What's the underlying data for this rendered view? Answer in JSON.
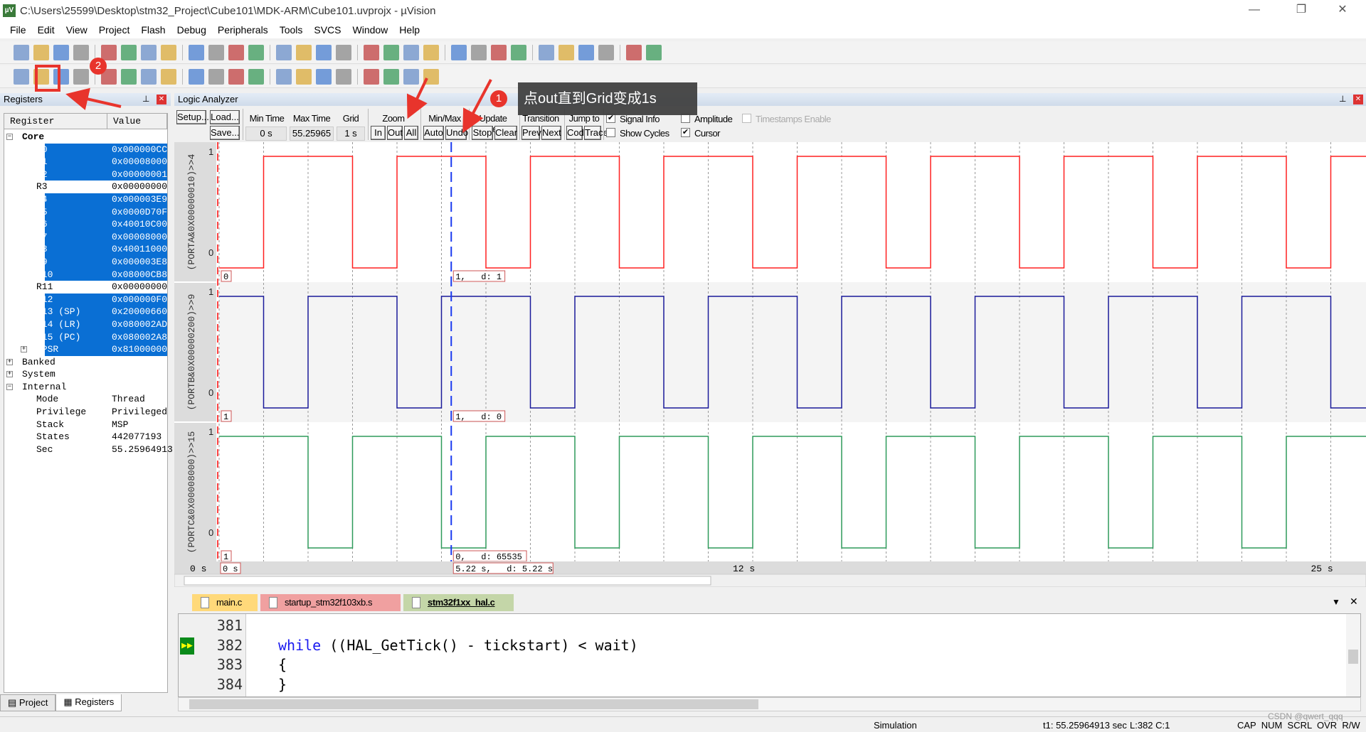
{
  "window": {
    "title": "C:\\Users\\25599\\Desktop\\stm32_Project\\Cube101\\MDK-ARM\\Cube101.uvprojx - µVision",
    "app_icon": "uvision-logo",
    "minimize": "—",
    "restore": "❐",
    "close": "✕"
  },
  "menu": [
    "File",
    "Edit",
    "View",
    "Project",
    "Flash",
    "Debug",
    "Peripherals",
    "Tools",
    "SVCS",
    "Window",
    "Help"
  ],
  "toolbar1": [
    "new-file",
    "open-file",
    "save",
    "save-all",
    "cut",
    "copy",
    "paste",
    "undo",
    "redo",
    "navigate-back",
    "navigate-forward",
    "bookmark-set",
    "bookmark-prev",
    "bookmark-next",
    "bookmark-clear",
    "indent",
    "unindent",
    "comment",
    "uncomment",
    "find-in-files",
    "target-dropdown",
    "incremental-find",
    "debug-session",
    "start-debug",
    "breakpoint-insert",
    "breakpoint-enable",
    "breakpoint-disable",
    "breakpoint-kill",
    "window-layout",
    "configure"
  ],
  "toolbar2": [
    "reset",
    "run",
    "stop",
    "step",
    "step-over",
    "step-out",
    "run-to-cursor",
    "show-next-statement",
    "command-window",
    "disassembly-window",
    "symbols-window",
    "registers-window",
    "call-stack-window",
    "watch-windows",
    "memory-windows",
    "serial-windows",
    "analysis-windows",
    "trace-windows",
    "system-viewer",
    "toolbox"
  ],
  "registers": {
    "title": "Registers",
    "col_register": "Register",
    "col_value": "Value",
    "rows": [
      {
        "name": "Core",
        "value": "",
        "level": 0,
        "bold": true,
        "expander": "−",
        "selected": false
      },
      {
        "name": "R0",
        "value": "0x000000CC",
        "level": 1,
        "selected": true
      },
      {
        "name": "R1",
        "value": "0x00008000",
        "level": 1,
        "selected": true
      },
      {
        "name": "R2",
        "value": "0x00000001",
        "level": 1,
        "selected": true
      },
      {
        "name": "R3",
        "value": "0x00000000",
        "level": 1,
        "selected": false
      },
      {
        "name": "R4",
        "value": "0x000003E9",
        "level": 1,
        "selected": true
      },
      {
        "name": "R5",
        "value": "0x0000D70F",
        "level": 1,
        "selected": true
      },
      {
        "name": "R6",
        "value": "0x40010C00",
        "level": 1,
        "selected": true
      },
      {
        "name": "R7",
        "value": "0x00008000",
        "level": 1,
        "selected": true
      },
      {
        "name": "R8",
        "value": "0x40011000",
        "level": 1,
        "selected": true
      },
      {
        "name": "R9",
        "value": "0x000003E8",
        "level": 1,
        "selected": true
      },
      {
        "name": "R10",
        "value": "0x08000CB8",
        "level": 1,
        "selected": true
      },
      {
        "name": "R11",
        "value": "0x00000000",
        "level": 1,
        "selected": false
      },
      {
        "name": "R12",
        "value": "0x000000F0",
        "level": 1,
        "selected": true
      },
      {
        "name": "R13 (SP)",
        "value": "0x20000660",
        "level": 1,
        "selected": true
      },
      {
        "name": "R14 (LR)",
        "value": "0x080002AD",
        "level": 1,
        "selected": true
      },
      {
        "name": "R15 (PC)",
        "value": "0x080002A8",
        "level": 1,
        "selected": true
      },
      {
        "name": "xPSR",
        "value": "0x81000000",
        "level": 1,
        "selected": true,
        "expander": "+"
      },
      {
        "name": "Banked",
        "value": "",
        "level": 0,
        "expander": "+",
        "selected": false
      },
      {
        "name": "System",
        "value": "",
        "level": 0,
        "expander": "+",
        "selected": false
      },
      {
        "name": "Internal",
        "value": "",
        "level": 0,
        "expander": "−",
        "selected": false
      },
      {
        "name": "Mode",
        "value": "Thread",
        "level": 1,
        "selected": false
      },
      {
        "name": "Privilege",
        "value": "Privileged",
        "level": 1,
        "selected": false
      },
      {
        "name": "Stack",
        "value": "MSP",
        "level": 1,
        "selected": false
      },
      {
        "name": "States",
        "value": "442077193",
        "level": 1,
        "selected": false
      },
      {
        "name": "Sec",
        "value": "55.25964913",
        "level": 1,
        "selected": false
      }
    ],
    "tabs": [
      "Project",
      "Registers"
    ]
  },
  "la": {
    "title": "Logic Analyzer",
    "setup": "Setup...",
    "load": "Load...",
    "save": "Save...",
    "min_time_label": "Min Time",
    "min_time": "0 s",
    "max_time_label": "Max Time",
    "max_time": "55.25965 s",
    "grid_label": "Grid",
    "grid": "1 s",
    "zoom_label": "Zoom",
    "zoom_in": "In",
    "zoom_out": "Out",
    "zoom_all": "All",
    "minmax_label": "Min/Max",
    "auto": "Auto",
    "undo": "Undo",
    "update_label": "Update Screen",
    "stop": "Stop",
    "clear": "Clear",
    "transition_label": "Transition",
    "prev": "Prev",
    "next": "Next",
    "jump_label": "Jump to",
    "code": "Code",
    "trace": "Trace",
    "signal_info": {
      "label": "Signal Info",
      "checked": true
    },
    "amplitude": {
      "label": "Amplitude",
      "checked": false
    },
    "timestamps": {
      "label": "Timestamps Enable",
      "checked": false,
      "disabled": true
    },
    "show_cycles": {
      "label": "Show Cycles",
      "checked": false
    },
    "cursor": {
      "label": "Cursor",
      "checked": true
    },
    "signals": [
      {
        "name": "(PORTA&0X00000010)>>4",
        "color": "#ff2020",
        "period_s": 3,
        "low_start_s": 0,
        "low_duration_s": 1,
        "y_max": "1",
        "y_min": "0",
        "start_label": "0",
        "cursor_label": "1,   d: 1"
      },
      {
        "name": "(PORTB&0X00000200)>>9",
        "color": "#1a1a9a",
        "period_s": 3,
        "low_start_s": 1,
        "low_duration_s": 1,
        "y_max": "1",
        "y_min": "0",
        "start_label": "1",
        "cursor_label": "1,   d: 0"
      },
      {
        "name": "(PORTC&0X00008000)>>15",
        "color": "#2e9a5a",
        "period_s": 3,
        "low_start_s": 2,
        "low_duration_s": 1,
        "y_max": "1",
        "y_min": "0",
        "start_label": "1",
        "cursor_label": "0,   d: 65535"
      }
    ],
    "cursor_time_s": 5.22,
    "cursor_color": "#1a3af0",
    "time_axis": {
      "left_label": "0 s",
      "start_box": "0 s",
      "cursor_box": "5.22 s,   d: 5.22 s",
      "tick_labels": [
        {
          "t": 12,
          "label": "12 s"
        },
        {
          "t": 25,
          "label": "25 s"
        }
      ]
    }
  },
  "editor": {
    "tabs": [
      {
        "label": "main.c",
        "color": "#ffd97a"
      },
      {
        "label": "startup_stm32f103xb.s",
        "color": "#f0a0a0"
      },
      {
        "label": "stm32f1xx_hal.c",
        "color": "#c4d6a8",
        "active": true
      }
    ],
    "lines": [
      {
        "no": "381",
        "kw": "",
        "text": ""
      },
      {
        "no": "382",
        "kw": "while",
        "text": " ((HAL_GetTick() - tickstart) < wait)",
        "current": true
      },
      {
        "no": "383",
        "kw": "",
        "text": "{"
      },
      {
        "no": "384",
        "kw": "",
        "text": "}"
      }
    ]
  },
  "status": {
    "mode": "Simulation",
    "t1": "t1: 55.25964913 sec",
    "pos": "L:382 C:1",
    "keys": "CAP  NUM  SCRL  OVR  R/W",
    "watermark": "CSDN @qwert_qqq"
  },
  "annotations": {
    "callout": "点out直到Grid变成1s",
    "badge1": "1",
    "badge2": "2",
    "color": "#e8342c"
  }
}
